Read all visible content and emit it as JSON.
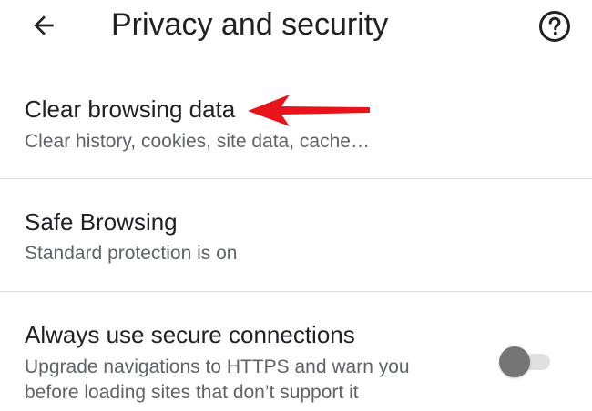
{
  "header": {
    "title": "Privacy and security",
    "back_icon": "arrow-back-icon",
    "help_icon": "help-circle-icon"
  },
  "settings": [
    {
      "title": "Clear browsing data",
      "subtitle": "Clear history, cookies, site data, cache…"
    },
    {
      "title": "Safe Browsing",
      "subtitle": "Standard protection is on"
    },
    {
      "title": "Always use secure connections",
      "subtitle_line1": "Upgrade navigations to HTTPS and warn you",
      "subtitle_line2": "before loading sites that don’t support it",
      "toggle_on": false
    }
  ],
  "annotation": {
    "arrow_color": "#e8141b"
  },
  "colors": {
    "text_primary": "#202124",
    "text_secondary": "#5f6368",
    "divider": "#dadce0",
    "toggle_thumb_off": "#757575",
    "toggle_track_off": "#e0e0e0"
  }
}
